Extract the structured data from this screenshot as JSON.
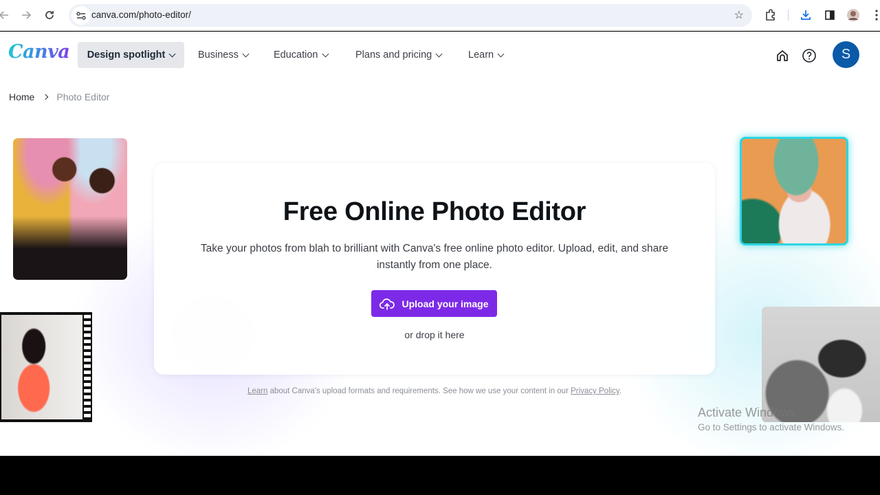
{
  "browser": {
    "url": "canva.com/photo-editor/",
    "icons": [
      "back-icon",
      "forward-icon",
      "reload-icon",
      "site-settings-icon",
      "bookmark-star-icon",
      "extensions-icon",
      "download-icon",
      "side-panel-icon",
      "profile-avatar",
      "more-menu-icon"
    ]
  },
  "nav": {
    "logo": "Canva",
    "items": [
      {
        "label": "Design spotlight",
        "active": true
      },
      {
        "label": "Business",
        "active": false
      },
      {
        "label": "Education",
        "active": false
      },
      {
        "label": "Plans and pricing",
        "active": false
      },
      {
        "label": "Learn",
        "active": false
      }
    ],
    "avatar_initial": "S",
    "avatar_color": "#0b5aa8"
  },
  "breadcrumb": {
    "home": "Home",
    "current": "Photo Editor"
  },
  "hero": {
    "title": "Free Online Photo Editor",
    "description": "Take your photos from blah to brilliant with Canva's free online photo editor. Upload, edit, and share instantly from one place.",
    "upload_button": "Upload your image",
    "drop_text": "or drop it here",
    "accent_color": "#7d2ae8"
  },
  "fineprint": {
    "learn_link": "Learn",
    "middle": " about Canva's upload formats and requirements. See how we use your content in our ",
    "privacy_link": "Privacy Policy",
    "end": "."
  },
  "watermark": {
    "line1": "Activate Windows",
    "line2": "Go to Settings to activate Windows."
  }
}
